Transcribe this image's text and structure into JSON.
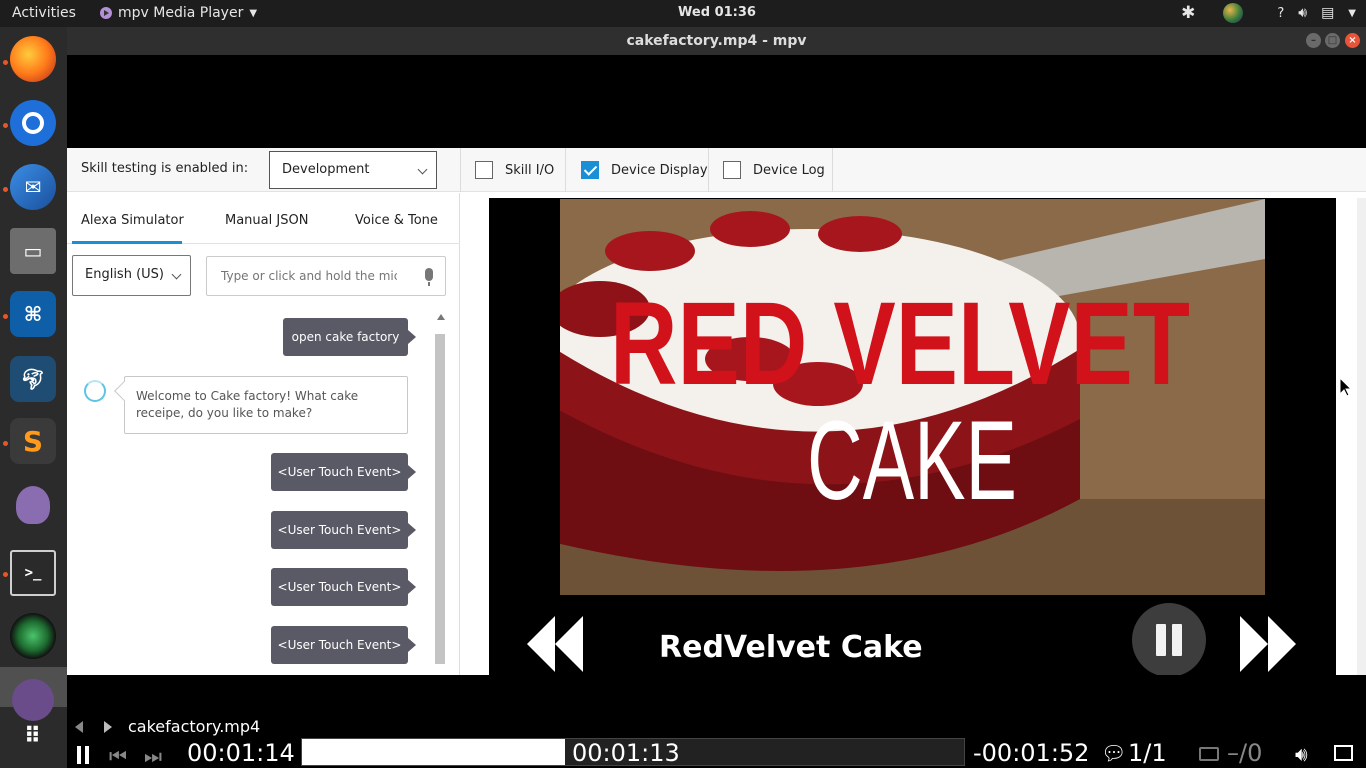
{
  "topbar": {
    "activities": "Activities",
    "app_name": "mpv Media Player",
    "clock": "Wed 01:36",
    "help": "?"
  },
  "window": {
    "title": "cakefactory.mp4 - mpv"
  },
  "dock": [
    {
      "name": "firefox-icon"
    },
    {
      "name": "chromium-icon"
    },
    {
      "name": "thunderbird-icon"
    },
    {
      "name": "files-icon"
    },
    {
      "name": "vscode-icon"
    },
    {
      "name": "mysql-workbench-icon"
    },
    {
      "name": "sublime-text-icon"
    },
    {
      "name": "pidgin-icon"
    },
    {
      "name": "terminal-icon"
    },
    {
      "name": "camera-icon"
    },
    {
      "name": "mpv-icon"
    },
    {
      "name": "app-grid-icon"
    }
  ],
  "skill": {
    "enabled_label": "Skill testing is enabled in:",
    "environment": "Development",
    "checks": [
      {
        "label": "Skill I/O",
        "checked": false
      },
      {
        "label": "Device Display",
        "checked": true
      },
      {
        "label": "Device Log",
        "checked": false
      }
    ]
  },
  "tabs": [
    "Alexa Simulator",
    "Manual JSON",
    "Voice & Tone"
  ],
  "locale": "English (US)",
  "utterance": {
    "placeholder": "Type or click and hold the mic"
  },
  "chat": {
    "user1": "open cake factory",
    "alexa": "Welcome to Cake factory! What cake receipe, do you like to make?",
    "touch1": "<User Touch Event>",
    "touch2": "<User Touch Event>",
    "touch3": "<User Touch Event>",
    "touch4": "<User Touch Event>"
  },
  "display": {
    "image_text_line1": "RED VELVET",
    "image_text_line2": "CAKE",
    "title": "RedVelvet Cake"
  },
  "player": {
    "filename": "cakefactory.mp4",
    "elapsed": "00:01:14",
    "cache": "00:01:13",
    "remaining": "-00:01:52",
    "subtitle_track": "1/1",
    "audio_track": "–/0",
    "progress_fraction": 0.397
  },
  "colors": {
    "accent": "#1a8fd6",
    "bubble": "#5a5a66",
    "title_red": "#d1121b"
  }
}
